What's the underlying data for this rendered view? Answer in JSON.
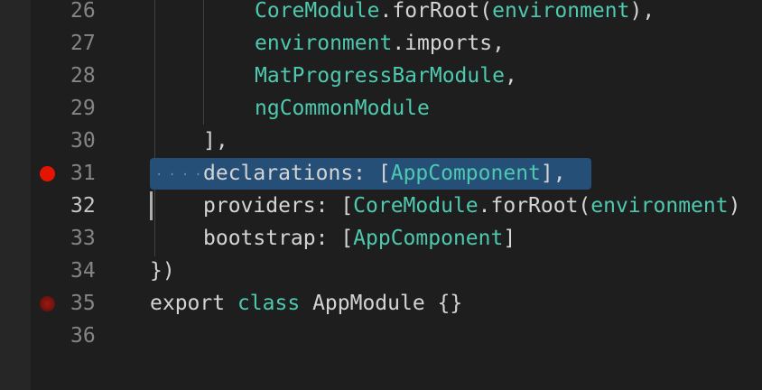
{
  "editor": {
    "lines": [
      {
        "num": "26",
        "segments": [
          {
            "text": "CoreModule",
            "cls": "t-cls"
          },
          {
            "text": ".",
            "cls": "t-txt"
          },
          {
            "text": "forRoot",
            "cls": "t-txt"
          },
          {
            "text": "(",
            "cls": "t-txt"
          },
          {
            "text": "environment",
            "cls": "t-cls"
          },
          {
            "text": "),",
            "cls": "t-txt"
          }
        ]
      },
      {
        "num": "27",
        "segments": [
          {
            "text": "environment",
            "cls": "t-cls"
          },
          {
            "text": ".imports,",
            "cls": "t-txt"
          }
        ]
      },
      {
        "num": "28",
        "segments": [
          {
            "text": "MatProgressBarModule",
            "cls": "t-cls"
          },
          {
            "text": ",",
            "cls": "t-txt"
          }
        ]
      },
      {
        "num": "29",
        "segments": [
          {
            "text": "ngCommonModule",
            "cls": "t-cls"
          }
        ]
      },
      {
        "num": "30",
        "segments": [
          {
            "text": "],",
            "cls": "t-txt"
          }
        ]
      },
      {
        "num": "31",
        "breakpoint": "solid",
        "selected": true,
        "segments": [
          {
            "text": "declarations",
            "cls": "t-txt"
          },
          {
            "text": ": [",
            "cls": "t-txt"
          },
          {
            "text": "AppComponent",
            "cls": "t-cls"
          },
          {
            "text": "],",
            "cls": "t-txt"
          }
        ]
      },
      {
        "num": "32",
        "active": true,
        "segments": [
          {
            "text": "providers",
            "cls": "t-txt"
          },
          {
            "text": ": [",
            "cls": "t-txt"
          },
          {
            "text": "CoreModule",
            "cls": "t-cls"
          },
          {
            "text": ".forRoot(",
            "cls": "t-txt"
          },
          {
            "text": "environment",
            "cls": "t-cls"
          },
          {
            "text": ")",
            "cls": "t-txt"
          }
        ]
      },
      {
        "num": "33",
        "segments": [
          {
            "text": "bootstrap",
            "cls": "t-txt"
          },
          {
            "text": ": [",
            "cls": "t-txt"
          },
          {
            "text": "AppComponent",
            "cls": "t-cls"
          },
          {
            "text": "]",
            "cls": "t-txt"
          }
        ]
      },
      {
        "num": "34",
        "segments": [
          {
            "text": "})",
            "cls": "t-txt"
          }
        ]
      },
      {
        "num": "35",
        "breakpoint": "hollow",
        "segments": [
          {
            "text": "export",
            "cls": "t-txt"
          },
          {
            "text": " ",
            "cls": "t-txt"
          },
          {
            "text": "class",
            "cls": "t-cls"
          },
          {
            "text": " ",
            "cls": "t-txt"
          },
          {
            "text": "AppModule",
            "cls": "t-txt"
          },
          {
            "text": " {}",
            "cls": "t-txt"
          }
        ]
      },
      {
        "num": "36",
        "segments": []
      }
    ]
  }
}
